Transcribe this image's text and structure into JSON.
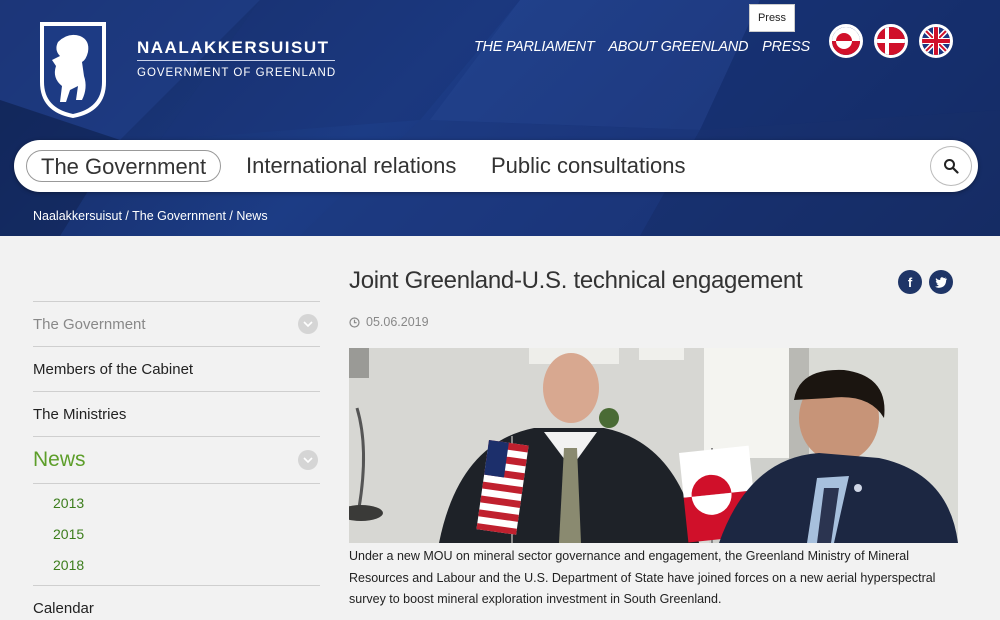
{
  "brand": {
    "name": "NAALAKKERSUISUT",
    "subtitle": "GOVERNMENT OF GREENLAND"
  },
  "topnav": [
    "THE PARLIAMENT",
    "ABOUT GREENLAND",
    "PRESS"
  ],
  "tooltip": "Press",
  "flags": [
    {
      "name": "greenland-flag-icon"
    },
    {
      "name": "denmark-flag-icon"
    },
    {
      "name": "uk-flag-icon"
    }
  ],
  "mainnav": {
    "items": [
      "The Government",
      "International relations",
      "Public consultations"
    ],
    "active": "The Government"
  },
  "breadcrumb": "Naalakkersuisut / The Government / News",
  "sidebar": {
    "items": {
      "gov": "The Government",
      "cabinet": "Members of the Cabinet",
      "ministries": "The Ministries",
      "news": "News",
      "calendar": "Calendar"
    },
    "news_years": [
      "2013",
      "2015",
      "2018"
    ]
  },
  "article": {
    "title": "Joint Greenland-U.S. technical engagement",
    "date": "05.06.2019",
    "caption": "Under a new MOU on mineral sector governance and engagement, the Greenland Ministry of Mineral Resources and Labour and the U.S. Department of State have joined forces on a new aerial hyperspectral survey to boost mineral exploration investment in South Greenland."
  },
  "colors": {
    "header_blue": "#1c3c85",
    "news_green": "#5d9e2a",
    "share_blue": "#1f3567"
  }
}
